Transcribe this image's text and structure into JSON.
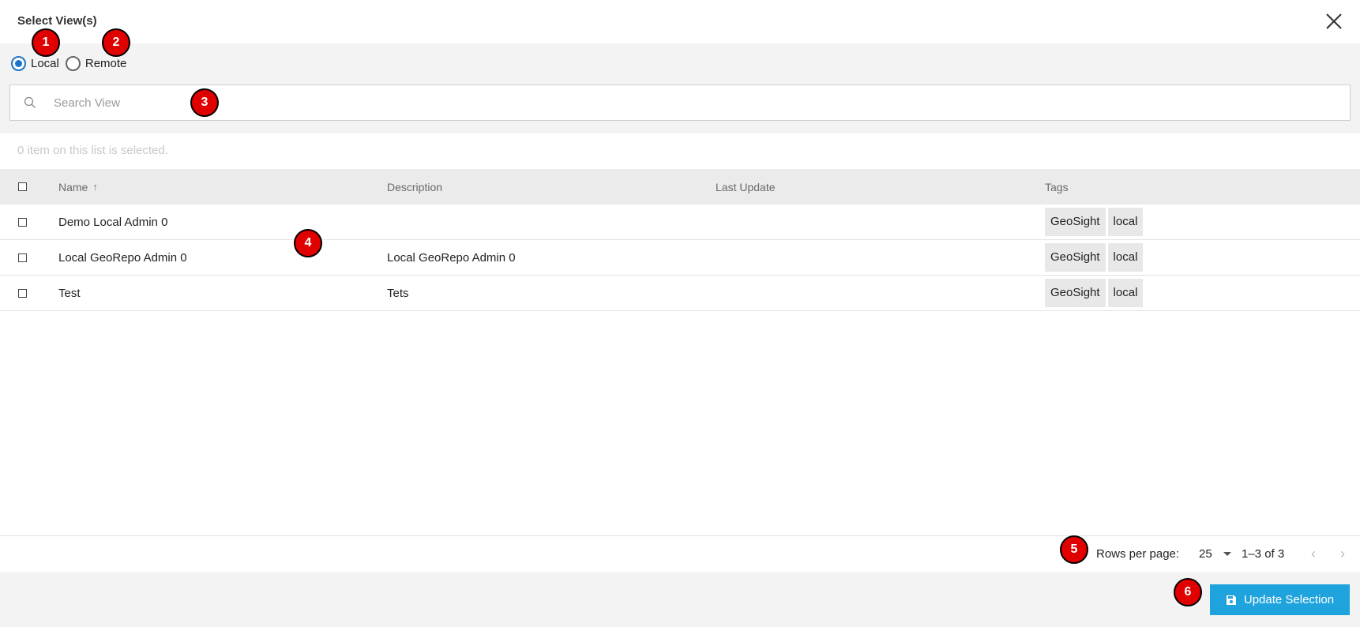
{
  "dialog": {
    "title": "Select View(s)"
  },
  "source": {
    "options": [
      "Local",
      "Remote"
    ],
    "selected": "Local"
  },
  "search": {
    "placeholder": "Search View",
    "value": ""
  },
  "selection": {
    "info": "0 item on this list is selected."
  },
  "table": {
    "columns": [
      "Name",
      "Description",
      "Last Update",
      "Tags"
    ],
    "sort": {
      "column": "Name",
      "direction": "ascending"
    },
    "rows": [
      {
        "name": "Demo Local Admin 0",
        "description": "",
        "last_update": "",
        "tags": [
          "GeoSight",
          "local"
        ]
      },
      {
        "name": "Local GeoRepo Admin 0",
        "description": "Local GeoRepo Admin 0",
        "last_update": "",
        "tags": [
          "GeoSight",
          "local"
        ]
      },
      {
        "name": "Test",
        "description": "Tets",
        "last_update": "",
        "tags": [
          "GeoSight",
          "local"
        ]
      }
    ]
  },
  "pagination": {
    "rows_per_page_label": "Rows per page:",
    "rows_per_page": "25",
    "range": "1–3 of 3"
  },
  "actions": {
    "update_label": "Update Selection"
  },
  "markers": [
    "1",
    "2",
    "3",
    "4",
    "5",
    "6"
  ],
  "colors": {
    "accent": "#1e73c8",
    "button": "#1fa3dc",
    "marker": "#e00000"
  }
}
